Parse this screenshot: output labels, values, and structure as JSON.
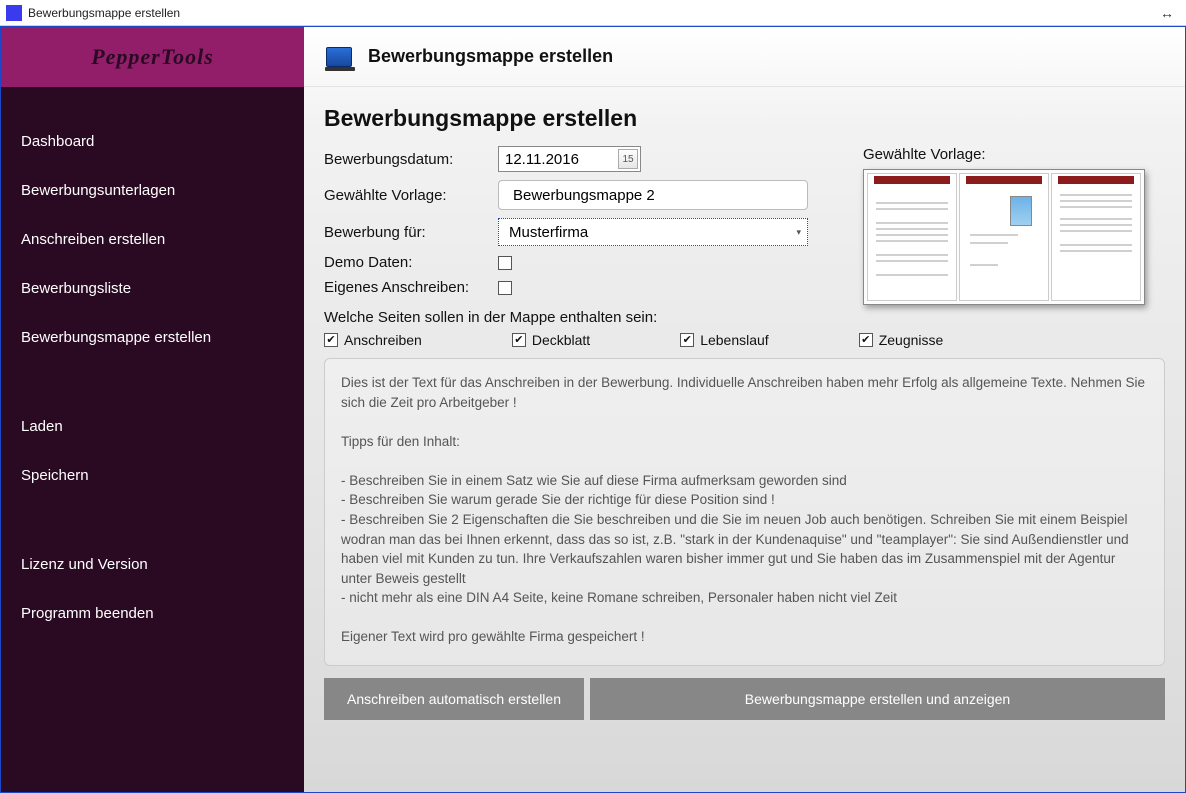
{
  "window": {
    "title": "Bewerbungsmappe erstellen"
  },
  "brand": "PepperTools",
  "sidebar": {
    "items": [
      {
        "label": "Dashboard"
      },
      {
        "label": "Bewerbungsunterlagen"
      },
      {
        "label": "Anschreiben erstellen"
      },
      {
        "label": "Bewerbungsliste"
      },
      {
        "label": "Bewerbungsmappe erstellen"
      },
      {
        "label": "Laden"
      },
      {
        "label": "Speichern"
      },
      {
        "label": "Lizenz und Version"
      },
      {
        "label": "Programm beenden"
      }
    ]
  },
  "header": {
    "title": "Bewerbungsmappe erstellen"
  },
  "page": {
    "title": "Bewerbungsmappe erstellen",
    "dateLabel": "Bewerbungsdatum:",
    "dateValue": "12.11.2016",
    "dateBadge": "15",
    "templateLabel": "Gewählte Vorlage:",
    "templateValue": "Bewerbungsmappe 2",
    "applyForLabel": "Bewerbung für:",
    "applyForValue": "Musterfirma",
    "demoLabel": "Demo Daten:",
    "ownLetterLabel": "Eigenes Anschreiben:",
    "previewTitle": "Gewählte Vorlage:",
    "sectionQuestion": "Welche Seiten sollen in der Mappe enthalten sein:",
    "checks": [
      {
        "label": "Anschreiben",
        "checked": true
      },
      {
        "label": "Deckblatt",
        "checked": true
      },
      {
        "label": "Lebenslauf",
        "checked": true
      },
      {
        "label": "Zeugnisse",
        "checked": true
      }
    ],
    "tipsText": "Dies ist der Text für das Anschreiben in der Bewerbung. Individuelle Anschreiben haben mehr Erfolg als allgemeine Texte. Nehmen Sie sich die Zeit pro Arbeitgeber !\n\nTipps für den Inhalt:\n\n- Beschreiben Sie in einem Satz wie Sie auf diese Firma aufmerksam geworden sind\n- Beschreiben Sie warum gerade Sie der richtige für diese Position sind !\n- Beschreiben Sie 2 Eigenschaften die Sie beschreiben und die Sie im neuen Job auch benötigen. Schreiben Sie mit einem Beispiel wodran man das bei Ihnen erkennt, dass das so ist, z.B. \"stark in der Kundenaquise\" und \"teamplayer\": Sie sind Außendienstler und haben viel mit Kunden zu tun. Ihre Verkaufszahlen waren bisher immer gut und Sie haben das im Zusammenspiel mit der Agentur unter Beweis gestellt\n- nicht mehr als eine DIN A4 Seite, keine Romane schreiben, Personaler haben nicht viel Zeit\n\nEigener Text wird pro gewählte Firma gespeichert !",
    "actions": {
      "autoCreate": "Anschreiben automatisch erstellen",
      "createShow": "Bewerbungsmappe erstellen und anzeigen"
    }
  }
}
